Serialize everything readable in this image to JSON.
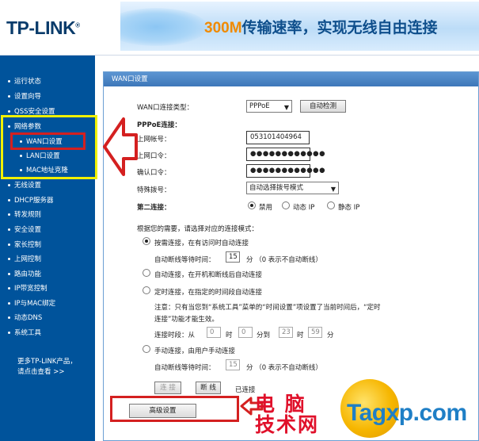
{
  "header": {
    "logo_text": "TP-LINK",
    "logo_reg": "®",
    "banner_speed": "300M",
    "banner_text": "传输速率，实现无线自由连接"
  },
  "sidebar": {
    "items": [
      {
        "label": "运行状态"
      },
      {
        "label": "设置向导"
      },
      {
        "label": "QSS安全设置"
      },
      {
        "label": "网络参数"
      },
      {
        "label": "WAN口设置"
      },
      {
        "label": "LAN口设置"
      },
      {
        "label": "MAC地址克隆"
      },
      {
        "label": "无线设置"
      },
      {
        "label": "DHCP服务器"
      },
      {
        "label": "转发规则"
      },
      {
        "label": "安全设置"
      },
      {
        "label": "家长控制"
      },
      {
        "label": "上网控制"
      },
      {
        "label": "路由功能"
      },
      {
        "label": "IP带宽控制"
      },
      {
        "label": "IP与MAC绑定"
      },
      {
        "label": "动态DNS"
      },
      {
        "label": "系统工具"
      }
    ],
    "more_line1": "更多TP-LINK产品，",
    "more_line2": "请点击查看 >>"
  },
  "panel": {
    "title": "WAN口设置",
    "conn_type_label": "WAN口连接类型：",
    "conn_type_value": "PPPoE",
    "auto_detect": "自动检测",
    "pppoe_heading": "PPPoE连接：",
    "account_label": "上网帐号：",
    "account_value": "053101404964",
    "password_label": "上网口令：",
    "password_value": "●●●●●●●●●●●●",
    "confirm_label": "确认口令：",
    "confirm_value": "●●●●●●●●●●●●",
    "dial_label": "特殊拨号：",
    "dial_value": "自动选择拨号模式",
    "second_conn_label": "第二连接：",
    "second_opts": [
      "禁用",
      "动态 IP",
      "静态 IP"
    ],
    "mode_prompt": "根据您的需要，请选择对应的连接模式：",
    "opt_ondemand": "按需连接，在有访问时自动连接",
    "idle_label": "自动断线等待时间：",
    "idle_value": "15",
    "idle_suffix": "分  （0 表示不自动断线）",
    "opt_auto": "自动连接，在开机和断线后自动连接",
    "opt_timed": "定时连接，在指定的时间段自动连接",
    "timed_note1": "注意：只有当您到“系统工具”菜单的“时间设置”项设置了当前时间后，“定时",
    "timed_note2": "连接”功能才能生效。",
    "period_label": "连接时段：从",
    "period_from_h": "0",
    "period_h": "时",
    "period_from_m": "0",
    "period_to": "分到",
    "period_to_h": "23",
    "period_to_m": "59",
    "period_m": "分",
    "opt_manual": "手动连接，由用户手动连接",
    "idle2_value": "15",
    "connect_btn": "连 接",
    "disconnect_btn": "断 线",
    "status": "已连接",
    "advanced_btn": "高级设置"
  },
  "watermark": {
    "cn_line1": "电 脑",
    "cn_line2": "技术网",
    "en": "Tagxp.com"
  },
  "colors": {
    "sidebar_bg": "#00539B",
    "highlight_yellow": "#F0F000",
    "highlight_red": "#D42020",
    "panel_title": "#3D77B9"
  }
}
